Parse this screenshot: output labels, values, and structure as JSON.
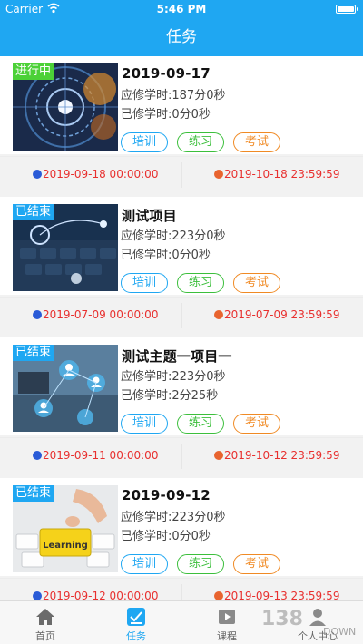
{
  "status_bar": {
    "carrier": "Carrier",
    "time": "5:46 PM"
  },
  "nav": {
    "title": "任务"
  },
  "tasks": [
    {
      "badge": "进行中",
      "title": "2019-09-17",
      "required": "应修学时:187分0秒",
      "done": "已修学时:0分0秒",
      "tags": [
        "培训",
        "练习",
        "考试"
      ],
      "start": "2019-09-18 00:00:00",
      "end": "2019-10-18 23:59:59"
    },
    {
      "badge": "已结束",
      "title": "测试项目",
      "required": "应修学时:223分0秒",
      "done": "已修学时:0分0秒",
      "tags": [
        "培训",
        "练习",
        "考试"
      ],
      "start": "2019-07-09 00:00:00",
      "end": "2019-07-09 23:59:59"
    },
    {
      "badge": "已结束",
      "title": "测试主题一项目一",
      "required": "应修学时:223分0秒",
      "done": "已修学时:2分25秒",
      "tags": [
        "培训",
        "练习",
        "考试"
      ],
      "start": "2019-09-11 00:00:00",
      "end": "2019-10-12 23:59:59"
    },
    {
      "badge": "已结束",
      "title": "2019-09-12",
      "required": "应修学时:223分0秒",
      "done": "已修学时:0分0秒",
      "tags": [
        "培训",
        "练习",
        "考试"
      ],
      "start": "2019-09-12 00:00:00",
      "end": "2019-09-13 23:59:59"
    }
  ],
  "thumb_texts": {
    "learning_key": "Learning"
  },
  "tab_bar": {
    "items": [
      {
        "label": "首页",
        "icon": "home-icon"
      },
      {
        "label": "任务",
        "icon": "task-icon"
      },
      {
        "label": "课程",
        "icon": "course-icon"
      },
      {
        "label": "个人中心",
        "icon": "profile-icon"
      }
    ]
  },
  "watermark": {
    "main": "138",
    "sub": "DOWN"
  },
  "colors": {
    "primary": "#1fa7f2",
    "running_badge": "#4cd137",
    "date_text": "#e8302f",
    "tag_train": "#1fa7f2",
    "tag_practice": "#3cbf3c",
    "tag_exam": "#f08a24"
  }
}
